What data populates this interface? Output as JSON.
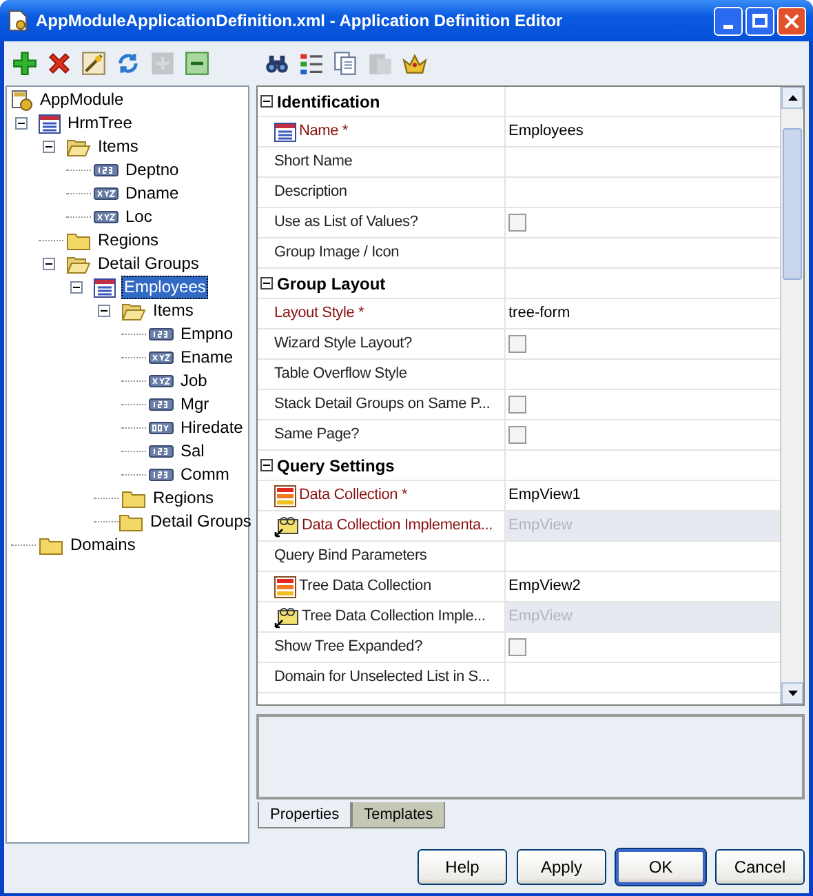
{
  "window": {
    "title": "AppModuleApplicationDefinition.xml - Application Definition Editor"
  },
  "tree_toolbar": [
    {
      "kind": "add",
      "disabled": false
    },
    {
      "kind": "delete",
      "disabled": false
    },
    {
      "kind": "wand",
      "disabled": false
    },
    {
      "kind": "refresh",
      "disabled": false
    },
    {
      "kind": "expand",
      "disabled": true
    },
    {
      "kind": "collapse",
      "disabled": false
    }
  ],
  "tree": [
    {
      "label": "AppModule",
      "kind": "module",
      "selected": false,
      "children": [
        {
          "label": "HrmTree",
          "kind": "group",
          "selected": false,
          "expanded": true,
          "children": [
            {
              "label": "Items",
              "kind": "folder",
              "selected": false,
              "expanded": true,
              "children": [
                {
                  "label": "Deptno",
                  "kind": "number",
                  "selected": false
                },
                {
                  "label": "Dname",
                  "kind": "string",
                  "selected": false
                },
                {
                  "label": "Loc",
                  "kind": "string",
                  "selected": false
                }
              ]
            },
            {
              "label": "Regions",
              "kind": "folder",
              "selected": false,
              "expanded": false
            },
            {
              "label": "Detail Groups",
              "kind": "folder",
              "selected": false,
              "expanded": true,
              "children": [
                {
                  "label": "Employees",
                  "kind": "group",
                  "selected": true,
                  "expanded": true,
                  "children": [
                    {
                      "label": "Items",
                      "kind": "folder",
                      "selected": false,
                      "expanded": true,
                      "children": [
                        {
                          "label": "Empno",
                          "kind": "number",
                          "selected": false
                        },
                        {
                          "label": "Ename",
                          "kind": "string",
                          "selected": false
                        },
                        {
                          "label": "Job",
                          "kind": "string",
                          "selected": false
                        },
                        {
                          "label": "Mgr",
                          "kind": "number",
                          "selected": false
                        },
                        {
                          "label": "Hiredate",
                          "kind": "date",
                          "selected": false
                        },
                        {
                          "label": "Sal",
                          "kind": "number",
                          "selected": false
                        },
                        {
                          "label": "Comm",
                          "kind": "number",
                          "selected": false
                        }
                      ]
                    },
                    {
                      "label": "Regions",
                      "kind": "folder",
                      "selected": false,
                      "expanded": false
                    },
                    {
                      "label": "Detail Groups",
                      "kind": "folder",
                      "selected": false,
                      "expanded": false
                    }
                  ]
                }
              ]
            }
          ]
        },
        {
          "label": "Domains",
          "kind": "folder",
          "selected": false,
          "expanded": false
        }
      ]
    }
  ],
  "property_toolbar": [
    {
      "kind": "find",
      "disabled": false
    },
    {
      "kind": "categorize",
      "disabled": false
    },
    {
      "kind": "copy",
      "disabled": false
    },
    {
      "kind": "paste",
      "disabled": true
    },
    {
      "kind": "crown",
      "disabled": false
    }
  ],
  "properties": [
    {
      "title": "Identification",
      "expanded": true,
      "rows": [
        {
          "label": "Name *",
          "required": true,
          "kind": "group",
          "value": "Employees",
          "readonly": false
        },
        {
          "label": "Short Name",
          "required": false,
          "kind": "text",
          "readonly": false
        },
        {
          "label": "Description",
          "required": false,
          "kind": "text",
          "readonly": false
        },
        {
          "label": "Use as List of Values?",
          "required": false,
          "kind": "checkbox",
          "checked": false,
          "readonly": false
        },
        {
          "label": "Group Image / Icon",
          "required": false,
          "kind": "text",
          "readonly": false
        }
      ]
    },
    {
      "title": "Group Layout",
      "expanded": true,
      "rows": [
        {
          "label": "Layout Style *",
          "required": true,
          "kind": "text",
          "value": "tree-form",
          "readonly": false
        },
        {
          "label": "Wizard Style Layout?",
          "required": false,
          "kind": "checkbox",
          "checked": false,
          "readonly": false
        },
        {
          "label": "Table Overflow Style",
          "required": false,
          "kind": "text",
          "readonly": false
        },
        {
          "label": "Stack Detail Groups on Same P...",
          "required": false,
          "kind": "checkbox",
          "checked": false,
          "readonly": false
        },
        {
          "label": "Same Page?",
          "required": false,
          "kind": "checkbox",
          "checked": false,
          "readonly": false
        }
      ]
    },
    {
      "title": "Query Settings",
      "expanded": true,
      "rows": [
        {
          "label": "Data Collection *",
          "required": true,
          "kind": "collection",
          "value": "EmpView1",
          "readonly": false
        },
        {
          "label": "Data Collection Implementa...",
          "required": true,
          "kind": "binding",
          "value": "EmpView",
          "readonly": true
        },
        {
          "label": "Query Bind Parameters",
          "required": false,
          "kind": "text",
          "readonly": false
        },
        {
          "label": "Tree Data Collection",
          "required": false,
          "kind": "collection",
          "value": "EmpView2",
          "readonly": false
        },
        {
          "label": "Tree Data Collection Imple...",
          "required": false,
          "kind": "binding",
          "value": "EmpView",
          "readonly": true
        },
        {
          "label": "Show Tree Expanded?",
          "required": false,
          "kind": "checkbox",
          "checked": false,
          "readonly": false
        },
        {
          "label": "Domain for Unselected List in S...",
          "required": false,
          "kind": "text",
          "readonly": false
        }
      ]
    }
  ],
  "bottom_tabs": [
    {
      "label": "Properties",
      "selected": true
    },
    {
      "label": "Templates",
      "selected": false
    }
  ],
  "buttons": [
    {
      "label": "Help",
      "default": false
    },
    {
      "label": "Apply",
      "default": false
    },
    {
      "label": "OK",
      "default": true
    },
    {
      "label": "Cancel",
      "default": false
    }
  ]
}
